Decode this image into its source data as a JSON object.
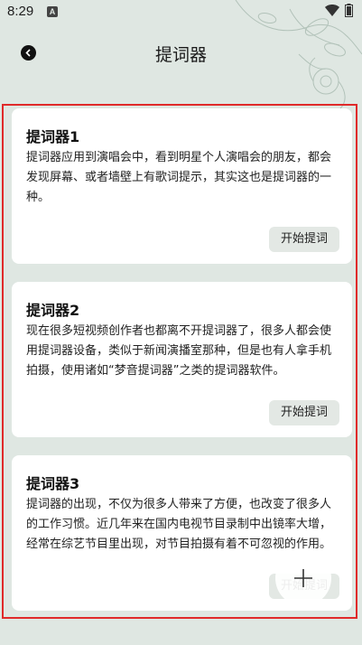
{
  "status_bar": {
    "time": "8:29",
    "notification_glyph": "A"
  },
  "header": {
    "title": "提词器"
  },
  "cards": [
    {
      "title": "提词器1",
      "body": "提词器应用到演唱会中，看到明星个人演唱会的朋友，都会发现屏幕、或者墙壁上有歌词提示，其实这也是提词器的一种。",
      "button": "开始提词"
    },
    {
      "title": "提词器2",
      "body": "现在很多短视频创作者也都离不开提词器了，很多人都会使用提词器设备，类似于新闻演播室那种，但是也有人拿手机拍摄，使用诸如“梦音提词器”之类的提词器软件。",
      "button": "开始提词"
    },
    {
      "title": "提词器3",
      "body": "提词器的出现，不仅为很多人带来了方便，也改变了很多人的工作习惯。近几年来在国内电视节目录制中出镜率大增，经常在综艺节目里出现，对节目拍摄有着不可忽视的作用。",
      "button": "开始提词"
    }
  ],
  "colors": {
    "background": "#dfe7e2",
    "card": "#ffffff",
    "button": "#e3e8e4",
    "highlight_border": "#e02a2a"
  },
  "icons": {
    "back": "back-arrow-icon",
    "add": "plus-icon",
    "wifi": "wifi-icon",
    "battery": "battery-icon"
  }
}
